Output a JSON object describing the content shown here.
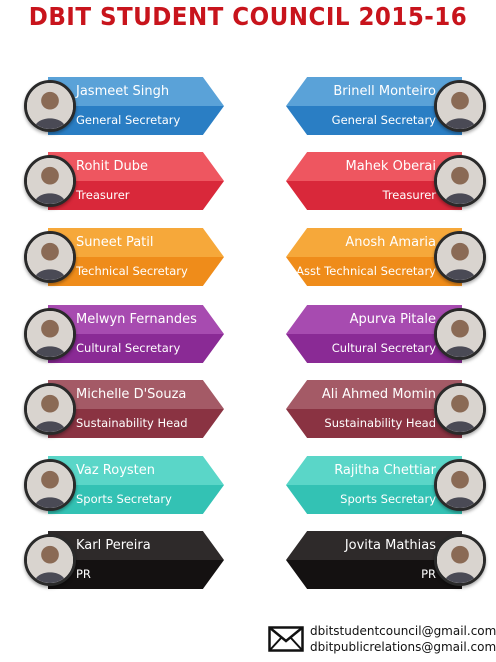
{
  "title": "DBIT STUDENT COUNCIL 2015-16",
  "members": [
    {
      "side": "left",
      "name": "Jasmeet Singh",
      "role": "General Secretary",
      "top": "#5aa2d8",
      "bottom": "#2a7ec4"
    },
    {
      "side": "right",
      "name": "Brinell Monteiro",
      "role": "General Secretary",
      "top": "#5aa2d8",
      "bottom": "#2a7ec4"
    },
    {
      "side": "left",
      "name": "Rohit  Dube",
      "role": "Treasurer",
      "top": "#ee5660",
      "bottom": "#d9283a"
    },
    {
      "side": "right",
      "name": "Mahek Oberai",
      "role": "Treasurer",
      "top": "#ee5660",
      "bottom": "#d9283a"
    },
    {
      "side": "left",
      "name": "Suneet Patil",
      "role": "Technical Secretary",
      "top": "#f6a83a",
      "bottom": "#ef8c1a"
    },
    {
      "side": "right",
      "name": "Anosh Amaria",
      "role": "Asst Technical Secretary",
      "top": "#f6a83a",
      "bottom": "#ef8c1a"
    },
    {
      "side": "left",
      "name": "Melwyn Fernandes",
      "role": "Cultural Secretary",
      "top": "#a74bb0",
      "bottom": "#8a2a95"
    },
    {
      "side": "right",
      "name": "Apurva Pitale",
      "role": "Cultural Secretary",
      "top": "#a74bb0",
      "bottom": "#8a2a95"
    },
    {
      "side": "left",
      "name": "Michelle D'Souza",
      "role": "Sustainability Head",
      "top": "#a45a66",
      "bottom": "#8a3342"
    },
    {
      "side": "right",
      "name": "Ali Ahmed Momin",
      "role": "Sustainability Head",
      "top": "#a45a66",
      "bottom": "#8a3342"
    },
    {
      "side": "left",
      "name": "Vaz Roysten",
      "role": "Sports Secretary",
      "top": "#5ad6c8",
      "bottom": "#33c2b4"
    },
    {
      "side": "right",
      "name": "Rajitha Chettiar",
      "role": "Sports Secretary",
      "top": "#5ad6c8",
      "bottom": "#33c2b4"
    },
    {
      "side": "left",
      "name": "Karl Pereira",
      "role": "PR",
      "top": "#2e2a2a",
      "bottom": "#141111"
    },
    {
      "side": "right",
      "name": "Jovita Mathias",
      "role": "PR",
      "top": "#2e2a2a",
      "bottom": "#141111"
    }
  ],
  "contact": {
    "icon": "envelope-icon",
    "email1": "dbitstudentcouncil@gmail.com",
    "email2": "dbitpublicrelations@gmail.com"
  },
  "colors": {
    "title": "#c8141c"
  }
}
